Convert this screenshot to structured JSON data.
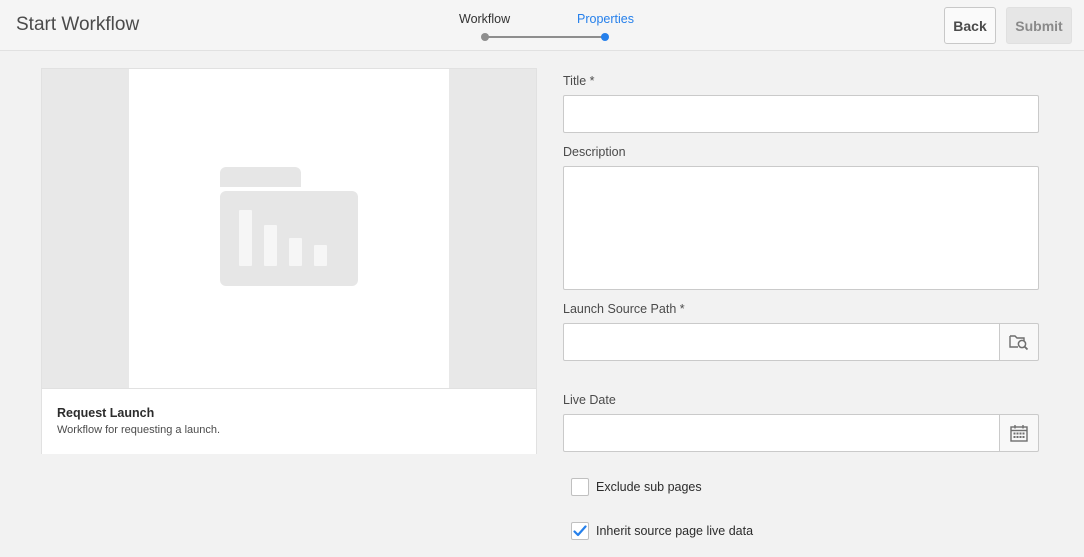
{
  "header": {
    "title": "Start Workflow",
    "steps": [
      {
        "label": "Workflow",
        "state": "completed"
      },
      {
        "label": "Properties",
        "state": "current"
      }
    ],
    "back_label": "Back",
    "submit_label": "Submit"
  },
  "colors": {
    "accent": "#2680eb",
    "step_inactive": "#8e8e8e",
    "background": "#f2f2f2"
  },
  "card": {
    "thumbnail_icon": "folder-chart-icon",
    "title": "Request Launch",
    "description": "Workflow for requesting a launch."
  },
  "form": {
    "title": {
      "label": "Title *",
      "value": ""
    },
    "description": {
      "label": "Description",
      "value": ""
    },
    "launch_source_path": {
      "label": "Launch Source Path *",
      "value": "",
      "button_icon": "folder-search-icon"
    },
    "live_date": {
      "label": "Live Date",
      "value": "",
      "button_icon": "calendar-icon"
    },
    "exclude_sub_pages": {
      "label": "Exclude sub pages",
      "checked": false
    },
    "inherit_live_data": {
      "label": "Inherit source page live data",
      "checked": true
    }
  }
}
